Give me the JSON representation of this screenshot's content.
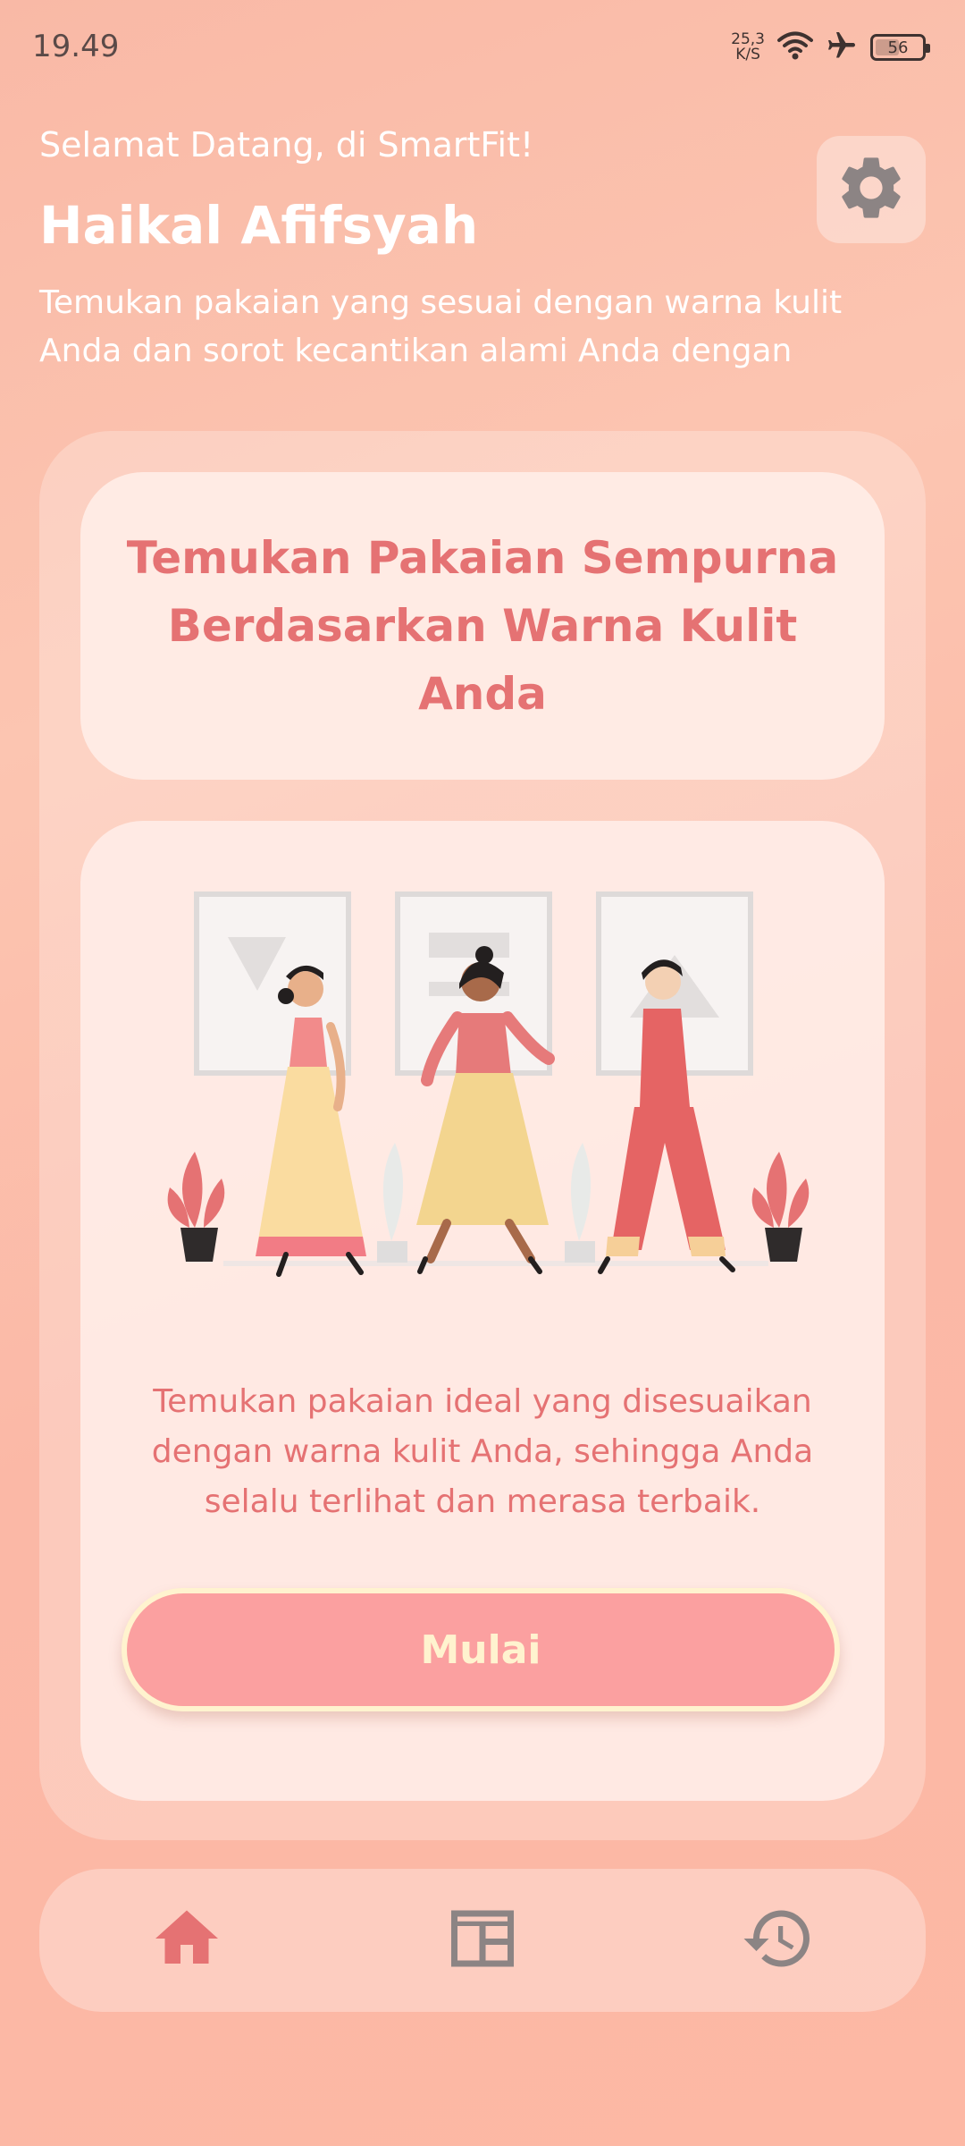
{
  "status_bar": {
    "time": "19.49",
    "net_speed_value": "25,3",
    "net_speed_unit": "K/S",
    "battery": "56",
    "icons": [
      "wifi-icon",
      "airplane-icon",
      "battery-icon"
    ]
  },
  "header": {
    "welcome": "Selamat Datang, di SmartFit!",
    "user_name": "Haikal Afifsyah",
    "intro": "Temukan pakaian yang sesuai dengan warna kulit Anda dan sorot kecantikan alami Anda dengan",
    "settings_icon": "gear-icon"
  },
  "main": {
    "title": "Temukan Pakaian Sempurna Berdasarkan Warna Kulit Anda",
    "description": "Temukan pakaian ideal yang disesuaikan dengan warna kulit Anda, sehingga Anda selalu terlihat dan merasa terbaik.",
    "start_button": "Mulai"
  },
  "nav": {
    "items": [
      {
        "icon": "home-icon",
        "active": true
      },
      {
        "icon": "catalog-icon",
        "active": false
      },
      {
        "icon": "history-icon",
        "active": false
      }
    ]
  },
  "colors": {
    "accent": "#e57273",
    "button": "#fba0a0",
    "button_text": "#fff3cf",
    "inactive_icon": "#8c8484"
  }
}
